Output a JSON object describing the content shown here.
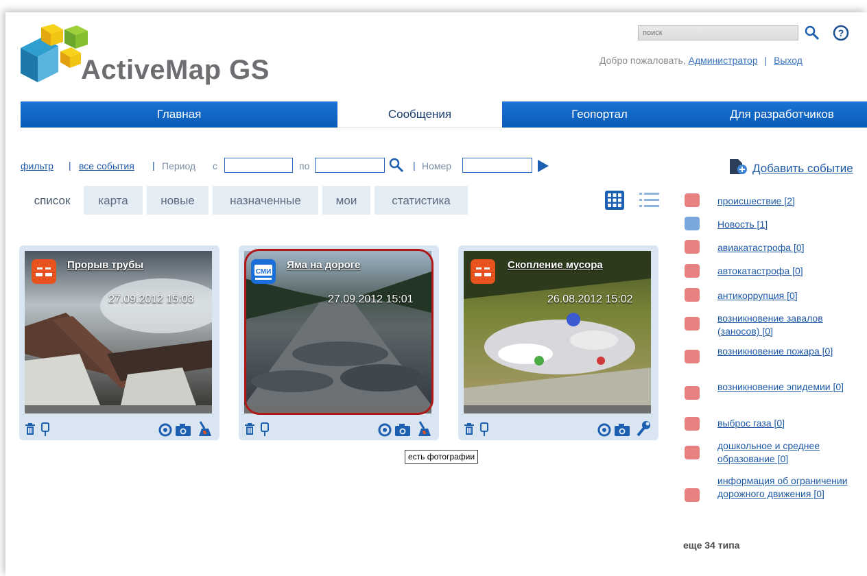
{
  "header": {
    "logo_text": "ActiveMap GS",
    "search_placeholder": "поиск",
    "welcome_prefix": "Добро пожаловать,",
    "user_link": "Администратор",
    "separator": "|",
    "logout_link": "Выход"
  },
  "nav": {
    "items": [
      {
        "label": "Главная"
      },
      {
        "label": "Сообщения"
      },
      {
        "label": "Геопортал"
      },
      {
        "label": "Для разработчиков"
      }
    ]
  },
  "filter": {
    "filter_link": "фильтр",
    "all_events_link": "все события",
    "period_label": "Период",
    "from_label": "с",
    "to_label": "по",
    "number_label": "Номер",
    "add_event_link": "Добавить событие"
  },
  "tabs": [
    {
      "label": "список"
    },
    {
      "label": "карта"
    },
    {
      "label": "новые"
    },
    {
      "label": "назначенные"
    },
    {
      "label": "мои"
    },
    {
      "label": "статистика"
    }
  ],
  "cards": [
    {
      "title": "Прорыв трубы",
      "date": "27.09.2012 15:03",
      "badge": "incident-icon"
    },
    {
      "title": "Яма на дороге",
      "date": "27.09.2012 15:01",
      "badge": "smi-icon",
      "badge_text": "СМИ"
    },
    {
      "title": "Скопление мусора",
      "date": "26.08.2012 15:02",
      "badge": "incident-icon"
    }
  ],
  "tooltip": "есть фотографии",
  "categories": [
    {
      "label": "происшествие [2]"
    },
    {
      "label": "Новость [1]"
    },
    {
      "label": "авиакатастрофа [0]"
    },
    {
      "label": "автокатастрофа [0]"
    },
    {
      "label": "антикоррупция [0]"
    },
    {
      "label": "возникновение завалов (заносов) [0]"
    },
    {
      "label": "возникновение пожара [0]"
    },
    {
      "label": "возникновение эпидемии [0]"
    },
    {
      "label": "выброс газа [0]"
    },
    {
      "label": "дошкольное и среднее образование [0]"
    },
    {
      "label": "информация об ограничении дорожного движения [0]"
    }
  ],
  "more_types": "еще 34 типа",
  "colors": {
    "nav_blue": "#0b5bb6",
    "link": "#1f5aa6",
    "card_bg": "#d9e5f1",
    "badge_orange": "#e8521e",
    "badge_blue": "#1a6fd8",
    "highlight": "#b01818"
  }
}
